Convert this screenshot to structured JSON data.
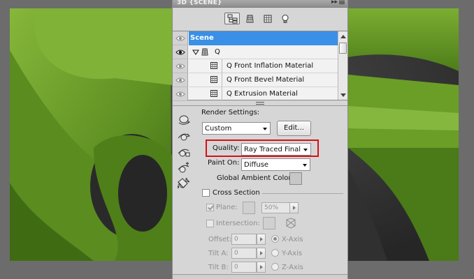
{
  "panel": {
    "title": "3D {SCENE}",
    "toolbar": [
      {
        "name": "scene-filter-icon",
        "active": true
      },
      {
        "name": "mesh-filter-icon",
        "active": false
      },
      {
        "name": "material-filter-icon",
        "active": false
      },
      {
        "name": "light-filter-icon",
        "active": false
      }
    ]
  },
  "tree": {
    "items": [
      {
        "label": "Scene",
        "selected": true,
        "type": "scene"
      },
      {
        "label": "Q",
        "selected": false,
        "type": "mesh",
        "expanded": true
      },
      {
        "label": "Q Front Inflation Material",
        "selected": false,
        "type": "material"
      },
      {
        "label": "Q Front Bevel Material",
        "selected": false,
        "type": "material"
      },
      {
        "label": "Q Extrusion Material",
        "selected": false,
        "type": "material"
      }
    ]
  },
  "render_settings": {
    "heading": "Render Settings:",
    "preset": "Custom",
    "edit_label": "Edit...",
    "quality_label": "Quality:",
    "quality_value": "Ray Traced Final",
    "paint_on_label": "Paint On:",
    "paint_on_value": "Diffuse",
    "ambient_label": "Global Ambient Color:",
    "ambient_color": "#c7c7c7"
  },
  "cross_section": {
    "label": "Cross Section",
    "checked": false,
    "plane_label": "Plane:",
    "plane_checked": true,
    "plane_opacity": "50%",
    "intersection_label": "Intersection:",
    "intersection_checked": false,
    "offset_label": "Offset:",
    "offset_value": "0",
    "tilt_a_label": "Tilt A:",
    "tilt_a_value": "0",
    "tilt_b_label": "Tilt B:",
    "tilt_b_value": "0",
    "x_axis_label": "X-Axis",
    "y_axis_label": "Y-Axis",
    "z_axis_label": "Z-Axis",
    "axis_selected": "X-Axis"
  },
  "colors": {
    "selection": "#3a8fe6",
    "highlight_box": "#d80f16",
    "model_green": "#6c9e2a"
  }
}
